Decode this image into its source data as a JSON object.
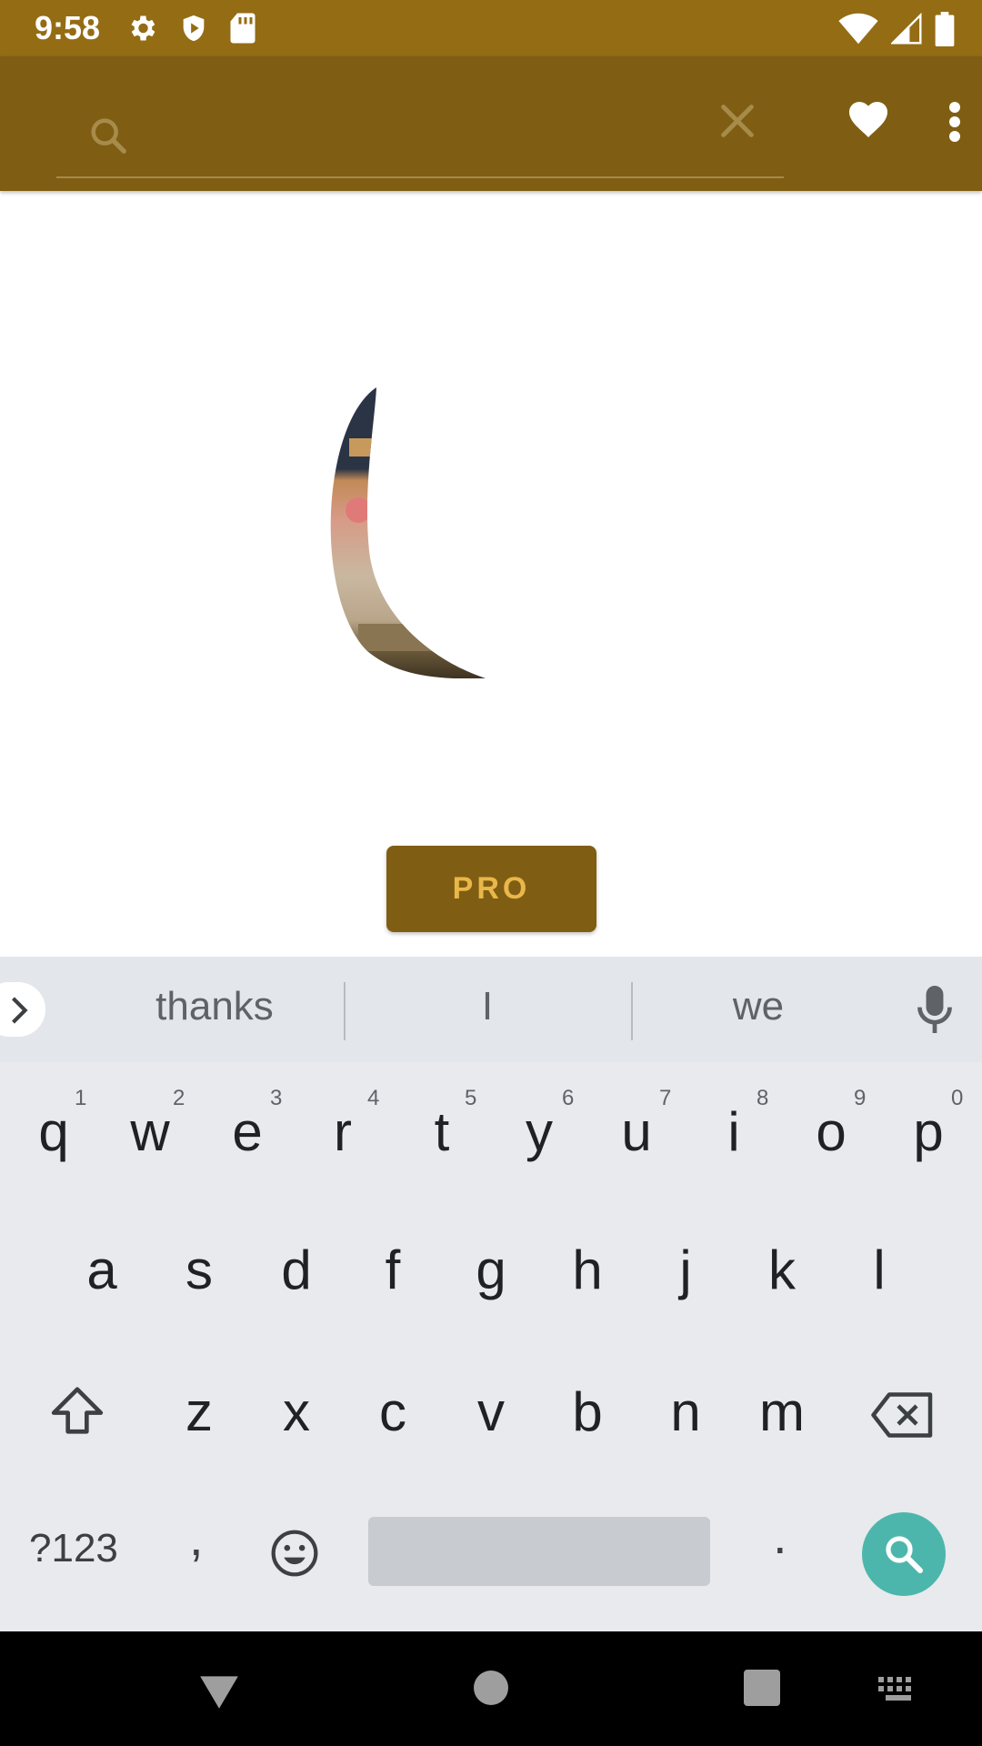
{
  "status_bar": {
    "time": "9:58",
    "left_icons": [
      "settings-icon",
      "shield-icon",
      "sd-card-icon"
    ],
    "right_icons": [
      "wifi-icon",
      "signal-icon",
      "battery-icon"
    ]
  },
  "app_bar": {
    "background": "#7f5e13",
    "search": {
      "value": "",
      "placeholder": ""
    },
    "icons": [
      "search-icon",
      "close-icon",
      "heart-icon",
      "more-vert-icon"
    ]
  },
  "content": {
    "image": "moon-crescent-photo",
    "pro_button_label": "PRO"
  },
  "keyboard": {
    "suggestions": [
      "thanks",
      "I",
      "we"
    ],
    "row1": [
      {
        "key": "q",
        "hint": "1"
      },
      {
        "key": "w",
        "hint": "2"
      },
      {
        "key": "e",
        "hint": "3"
      },
      {
        "key": "r",
        "hint": "4"
      },
      {
        "key": "t",
        "hint": "5"
      },
      {
        "key": "y",
        "hint": "6"
      },
      {
        "key": "u",
        "hint": "7"
      },
      {
        "key": "i",
        "hint": "8"
      },
      {
        "key": "o",
        "hint": "9"
      },
      {
        "key": "p",
        "hint": "0"
      }
    ],
    "row2": [
      "a",
      "s",
      "d",
      "f",
      "g",
      "h",
      "j",
      "k",
      "l"
    ],
    "row3": [
      "z",
      "x",
      "c",
      "v",
      "b",
      "n",
      "m"
    ],
    "symbols_label": "?123",
    "comma": ",",
    "period": ".",
    "action_color": "#4db6ac"
  },
  "nav_bar": {
    "icons": [
      "back-icon",
      "home-icon",
      "recents-icon",
      "keyboard-icon"
    ]
  }
}
